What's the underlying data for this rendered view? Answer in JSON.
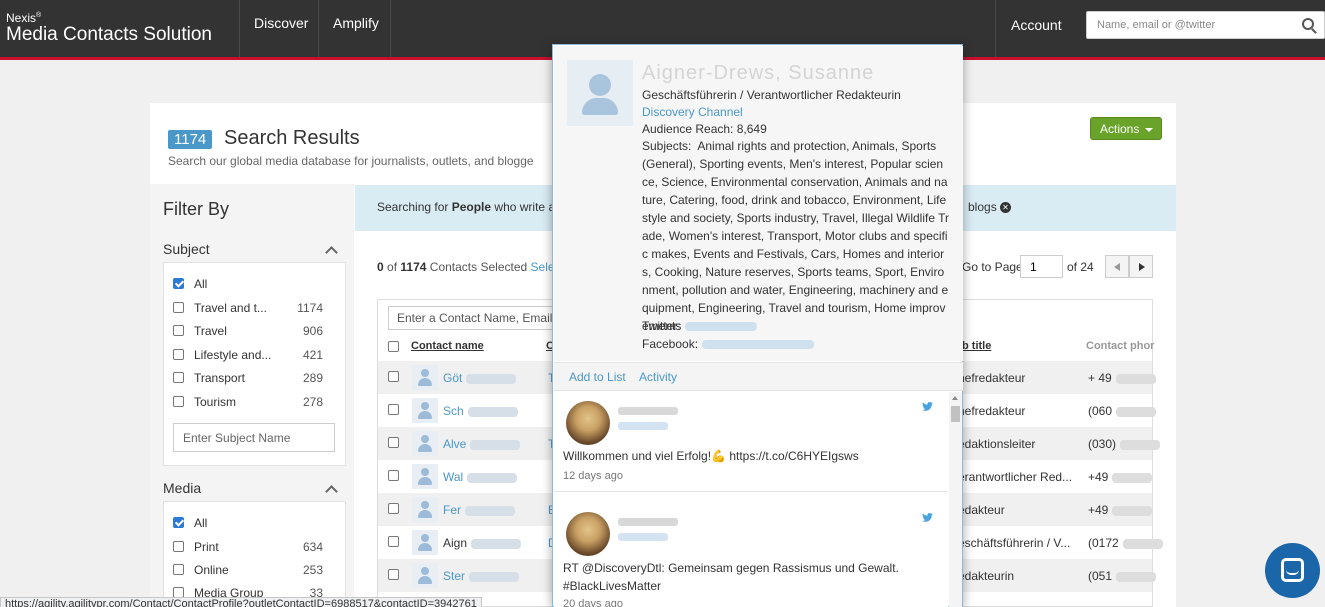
{
  "header": {
    "brand_line1": "Nexis",
    "brand_reg": "®",
    "brand_line2": "Media Contacts Solution",
    "nav": [
      "Discover",
      "Amplify"
    ],
    "account": "Account",
    "search_placeholder": "Name, email or @twitter"
  },
  "results": {
    "count": "1174",
    "title": "Search Results",
    "subtitle": "Search our global media database for journalists, outlets, and blogge",
    "actions_label": "Actions"
  },
  "filters": {
    "heading": "Filter By",
    "subject": {
      "title": "Subject",
      "items": [
        {
          "label": "All",
          "count": "",
          "checked": true
        },
        {
          "label": "Travel and t...",
          "count": "1174",
          "checked": false
        },
        {
          "label": "Travel",
          "count": "906",
          "checked": false
        },
        {
          "label": "Lifestyle and...",
          "count": "421",
          "checked": false
        },
        {
          "label": "Transport",
          "count": "289",
          "checked": false
        },
        {
          "label": "Tourism",
          "count": "278",
          "checked": false
        }
      ],
      "input_placeholder": "Enter Subject Name"
    },
    "media": {
      "title": "Media",
      "items": [
        {
          "label": "All",
          "count": "",
          "checked": true
        },
        {
          "label": "Print",
          "count": "634",
          "checked": false
        },
        {
          "label": "Online",
          "count": "253",
          "checked": false
        },
        {
          "label": "Media Group",
          "count": "33",
          "checked": false
        }
      ]
    }
  },
  "banner": {
    "prefix": "Searching for",
    "entity": "People",
    "middle": "who write a",
    "tail": "blogs"
  },
  "selection": {
    "count": "0",
    "of": "of",
    "total": "1174",
    "label": "Contacts Selected",
    "link": "Sele"
  },
  "pagination": {
    "goto_label": "Go to Page",
    "page": "1",
    "of_pages": "of 24"
  },
  "table": {
    "search_placeholder": "Enter a Contact Name, Email",
    "headers": {
      "name": "Contact name",
      "outlet": "O",
      "job": "b title",
      "phone": "Contact phor"
    },
    "rows": [
      {
        "name": "Göt",
        "outlet": "T",
        "job": "hefredakteur",
        "phone": "+ 49"
      },
      {
        "name": "Sch",
        "outlet": "",
        "job": "hefredakteur",
        "phone": "(060"
      },
      {
        "name": "Alve",
        "outlet": "T",
        "job": "edaktionsleiter",
        "phone": "(030)"
      },
      {
        "name": "Wal",
        "outlet": "",
        "job": "erantwortlicher Red...",
        "phone": "+49"
      },
      {
        "name": "Fer",
        "outlet": "E",
        "job": "edakteur",
        "phone": "+49"
      },
      {
        "name": "Aign",
        "outlet": "D",
        "job": "eschäftsführerin / V...",
        "phone": "(0172"
      },
      {
        "name": "Ster",
        "outlet": "",
        "job": "edakteurin",
        "phone": "(051"
      }
    ]
  },
  "popup": {
    "name": "Aigner-Drews, Susanne",
    "role": "Geschäftsführerin / Verantwortlicher Redakteurin",
    "outlet": "Discovery Channel",
    "reach_label": "Audience Reach:",
    "reach": "8,649",
    "subjects_label": "Subjects:",
    "subjects": "Animal rights and protection, Animals, Sports (General), Sporting events, Men's interest, Popular science, Science, Environmental conservation, Animals and nature, Catering, food, drink and tobacco, Environment, Lifestyle and society, Sports industry, Travel, Illegal Wildlife Trade, Women's interest, Transport, Motor clubs and specific makes, Events and Festivals, Cars, Homes and interiors, Cooking, Nature reserves, Sports teams, Sport, Environment, pollution and water, Engineering, machinery and equipment, Engineering, Travel and tourism, Home improvements",
    "twitter_label": "Twitter:",
    "facebook_label": "Facebook:",
    "actions": [
      "Add to List",
      "Activity"
    ],
    "tweets": [
      {
        "text": "Willkommen und viel Erfolg!💪 https://t.co/C6HYEIgsws",
        "time": "12 days ago"
      },
      {
        "text": "RT @DiscoveryDtl: Gemeinsam gegen Rassismus und Gewalt. #BlackLivesMatter",
        "time": "20 days ago"
      }
    ]
  },
  "status_url": "https://agility.agilitypr.com/Contact/ContactProfile?outletContactID=6988517&contactID=3942761",
  "colors": {
    "accent": "#4a97c9",
    "topbar": "#333333",
    "brand_red": "#c8102e",
    "actions_green": "#6aa32a",
    "chat_blue": "#1a66a8"
  }
}
